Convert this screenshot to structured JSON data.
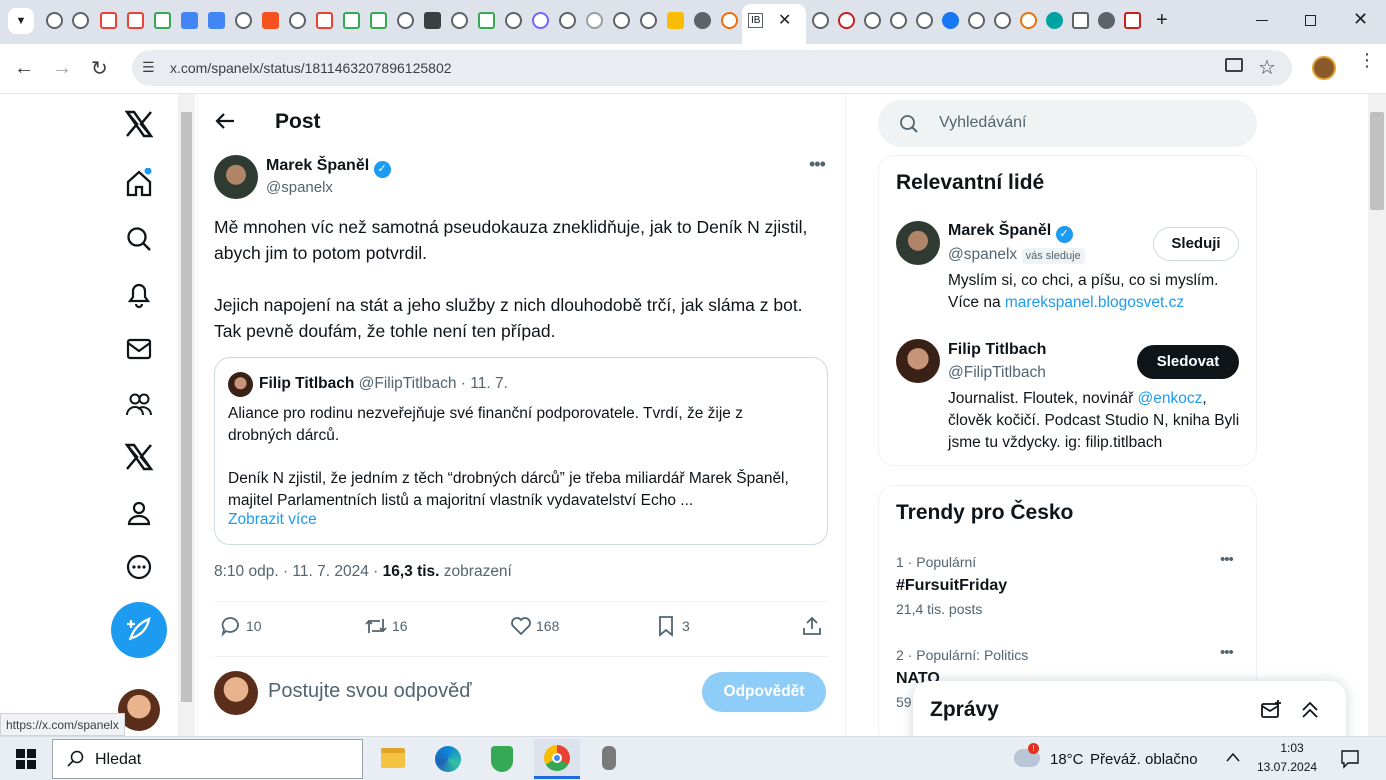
{
  "browser": {
    "url": "x.com/spanelx/status/1811463207896125802",
    "active_tab_label": "IB",
    "status_url": "https://x.com/spanelx"
  },
  "post_header": {
    "title": "Post"
  },
  "post": {
    "author_name": "Marek Španěl",
    "author_handle": "@spanelx",
    "paragraph1": "Mě mnohen víc než samotná pseudokauza  zneklidňuje, jak to Deník N zjistil, abych jim to potom potvrdil.",
    "paragraph2": "Jejich napojení na stát a jeho služby z nich dlouhodobě trčí, jak sláma z bot. Tak pevně doufám, že tohle není ten případ.",
    "quote": {
      "author_name": "Filip Titlbach",
      "author_handle": "@FilipTitlbach",
      "date": "· 11. 7.",
      "text1": "Aliance pro rodinu nezveřejňuje své finanční podporovatele. Tvrdí, že žije z drobných dárců.",
      "text2": "Deník N zjistil, že jedním z těch “drobných dárců” je třeba miliardář Marek Španěl, majitel Parlamentních listů a majoritní vlastník vydavatelství Echo ...",
      "show_more": "Zobrazit více"
    },
    "meta_time": "8:10 odp. · 11. 7. 2024 · ",
    "views_count": "16,3 tis.",
    "views_label": " zobrazení",
    "replies": "10",
    "reposts": "16",
    "likes": "168",
    "bookmarks": "3"
  },
  "reply_box": {
    "placeholder": "Postujte svou odpověď",
    "button": "Odpovědět"
  },
  "search": {
    "placeholder": "Vyhledávání"
  },
  "relevant_people": {
    "title": "Relevantní lidé",
    "people": [
      {
        "name": "Marek Španěl",
        "handle": "@spanelx",
        "badge": "vás sleduje",
        "button": "Sleduji",
        "bio": "Myslím si, co chci, a píšu, co si myslím. Více na ",
        "bio_link": "marekspanel.blogosvet.cz"
      },
      {
        "name": "Filip Titlbach",
        "handle": "@FilipTitlbach",
        "button": "Sledovat",
        "bio_pre": "Journalist. Floutek, novinář ",
        "bio_link": "@enkocz",
        "bio_post": ", člověk kočičí. Podcast Studio N, kniha Byli jsme tu vždycky. ig: filip.titlbach"
      }
    ]
  },
  "trends": {
    "title": "Trendy pro Česko",
    "items": [
      {
        "meta": "1 · Populární",
        "name": "#FursuitFriday",
        "count": "21,4 tis. posts"
      },
      {
        "meta": "2 · Populární: Politics",
        "name": "NATO",
        "count": "59"
      }
    ]
  },
  "messages": {
    "title": "Zprávy"
  },
  "taskbar": {
    "search_placeholder": "Hledat",
    "weather_temp": "18°C",
    "weather_text": "Převáž. oblačno",
    "time": "1:03",
    "date": "13.07.2024"
  },
  "colors": {
    "accent": "#1d9bf0",
    "text": "#0f1419",
    "muted": "#536471"
  }
}
